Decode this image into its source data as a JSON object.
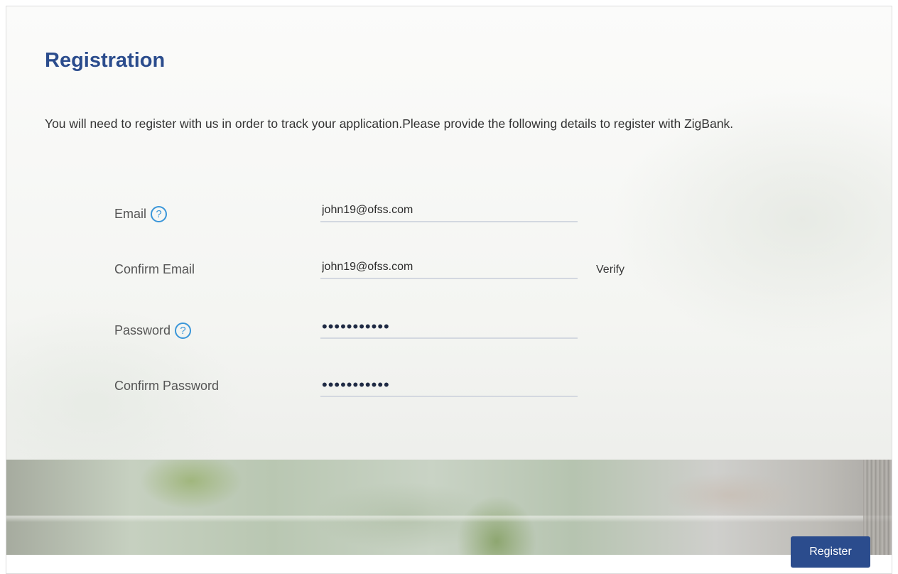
{
  "page": {
    "title": "Registration",
    "intro": "You will need to register with us in order to track your application.Please provide the following details to register with ZigBank."
  },
  "form": {
    "email": {
      "label": "Email",
      "value": "john19@ofss.com",
      "help_icon": "question-circle-icon"
    },
    "confirm_email": {
      "label": "Confirm Email",
      "value": "john19@ofss.com",
      "verify_label": "Verify"
    },
    "password": {
      "label": "Password",
      "value": "•••••••••••",
      "help_icon": "question-circle-icon"
    },
    "confirm_password": {
      "label": "Confirm Password",
      "value": "•••••••••••"
    },
    "help_glyph": "?"
  },
  "actions": {
    "register_label": "Register"
  },
  "colors": {
    "primary": "#2b4c8d",
    "help_icon": "#3a96d9",
    "field_underline": "#d3d8e0"
  }
}
